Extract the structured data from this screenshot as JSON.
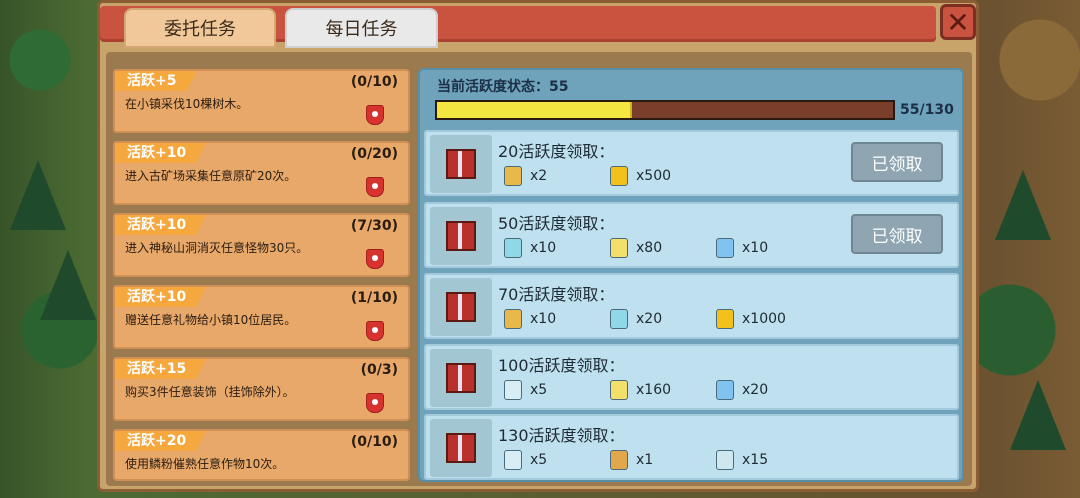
{
  "tabs": [
    {
      "label": "委托任务"
    },
    {
      "label": "每日任务"
    }
  ],
  "close_label": "✕",
  "quests": [
    {
      "badge": "活跃+5",
      "progress": "(0/10)",
      "desc": "在小镇采伐10棵树木。"
    },
    {
      "badge": "活跃+10",
      "progress": "(0/20)",
      "desc": "进入古矿场采集任意原矿20次。"
    },
    {
      "badge": "活跃+10",
      "progress": "(7/30)",
      "desc": "进入神秘山洞消灭任意怪物30只。"
    },
    {
      "badge": "活跃+10",
      "progress": "(1/10)",
      "desc": "赠送任意礼物给小镇10位居民。"
    },
    {
      "badge": "活跃+15",
      "progress": "(0/3)",
      "desc": "购买3件任意装饰（挂饰除外）。"
    },
    {
      "badge": "活跃+20",
      "progress": "(0/10)",
      "desc": "使用鳞粉催熟任意作物10次。"
    }
  ],
  "activity": {
    "status_label": "当前活跃度状态：55",
    "progress_text": "55/130",
    "progress_fraction": 0.423
  },
  "rewards": [
    {
      "title": "20活跃度领取：",
      "items": [
        {
          "icon": "bottle-icon",
          "color": "#e9b84a",
          "qty": "x2"
        },
        {
          "icon": "gold-coin-icon",
          "color": "#f2c21a",
          "qty": "x500"
        }
      ],
      "claim": "已领取"
    },
    {
      "title": "50活跃度领取：",
      "items": [
        {
          "icon": "potion-icon",
          "color": "#8fd8e8",
          "qty": "x10"
        },
        {
          "icon": "star-icon",
          "color": "#f3e06a",
          "qty": "x80"
        },
        {
          "icon": "diamond-icon",
          "color": "#7fc4f0",
          "qty": "x10"
        }
      ],
      "claim": "已领取"
    },
    {
      "title": "70活跃度领取：",
      "items": [
        {
          "icon": "bottle-icon",
          "color": "#e9b84a",
          "qty": "x10"
        },
        {
          "icon": "potion-icon",
          "color": "#8fd8e8",
          "qty": "x20"
        },
        {
          "icon": "gold-coin-icon",
          "color": "#f2c21a",
          "qty": "x1000"
        }
      ],
      "claim": ""
    },
    {
      "title": "100活跃度领取：",
      "items": [
        {
          "icon": "jar-icon",
          "color": "#d8eef4",
          "qty": "x5"
        },
        {
          "icon": "star-icon",
          "color": "#f3e06a",
          "qty": "x160"
        },
        {
          "icon": "diamond-icon",
          "color": "#7fc4f0",
          "qty": "x20"
        }
      ],
      "claim": ""
    },
    {
      "title": "130活跃度领取：",
      "items": [
        {
          "icon": "jar-icon",
          "color": "#d8eef4",
          "qty": "x5"
        },
        {
          "icon": "scroll-icon",
          "color": "#e0a84a",
          "qty": "x1"
        },
        {
          "icon": "ice-block-icon",
          "color": "#cfe8f0",
          "qty": "x15"
        }
      ],
      "claim": ""
    }
  ]
}
